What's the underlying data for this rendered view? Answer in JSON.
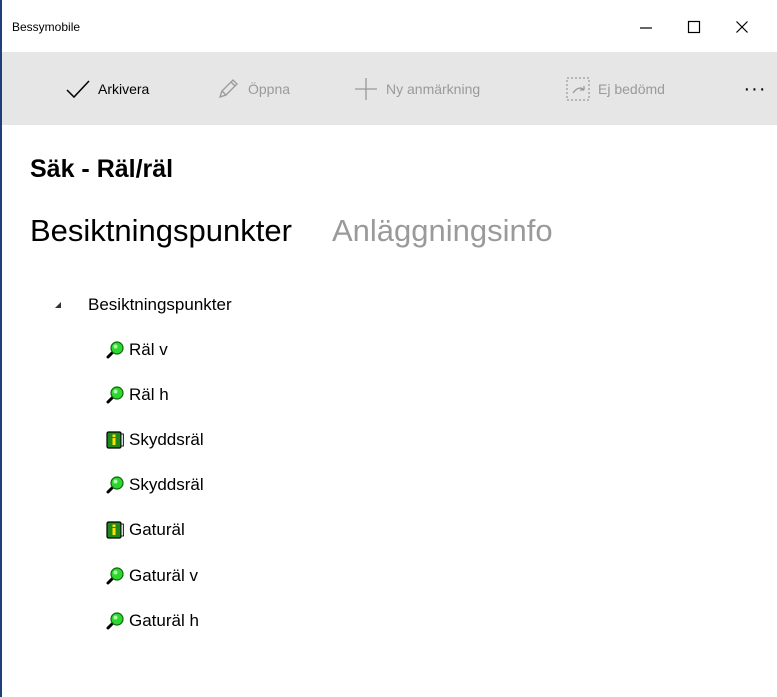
{
  "window": {
    "title": "Bessymobile",
    "minimize_icon": "minimize-icon",
    "maximize_icon": "maximize-icon",
    "close_icon": "close-icon"
  },
  "toolbar": {
    "archive_label": "Arkivera",
    "open_label": "Öppna",
    "new_note_label": "Ny anmärkning",
    "not_assessed_label": "Ej bedömd",
    "more_label": "···"
  },
  "page": {
    "title": "Säk - Räl/räl"
  },
  "tabs": [
    {
      "label": "Besiktningspunkter",
      "active": true
    },
    {
      "label": "Anläggningsinfo",
      "active": false
    }
  ],
  "tree": {
    "root_label": "Besiktningspunkter",
    "expanded": true,
    "items": [
      {
        "label": "Räl v",
        "icon": "magnifier-icon"
      },
      {
        "label": "Räl h",
        "icon": "magnifier-icon"
      },
      {
        "label": "Skyddsräl",
        "icon": "info-book-icon"
      },
      {
        "label": "Skyddsräl",
        "icon": "magnifier-icon"
      },
      {
        "label": "Gaturäl",
        "icon": "info-book-icon"
      },
      {
        "label": "Gaturäl v",
        "icon": "magnifier-icon"
      },
      {
        "label": "Gaturäl h",
        "icon": "magnifier-icon"
      }
    ]
  },
  "colors": {
    "toolbar_bg": "#e6e6e6",
    "disabled_text": "#9a9a9a",
    "magnifier_green": "#2fd62f",
    "book_green": "#1e8a1e",
    "window_border": "#1f3f7a"
  }
}
